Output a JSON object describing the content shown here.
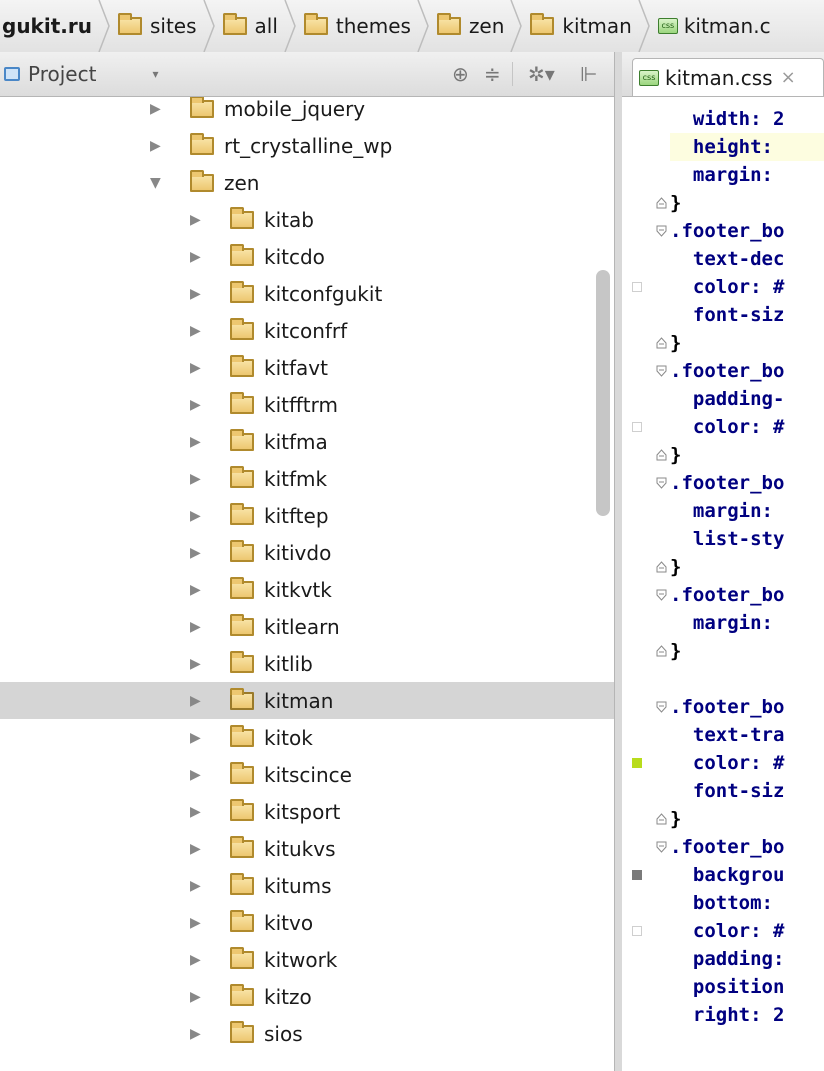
{
  "breadcrumb": {
    "items": [
      {
        "label": "gukit.ru",
        "icon": "none"
      },
      {
        "label": "sites",
        "icon": "folder-icon"
      },
      {
        "label": "all",
        "icon": "folder-icon"
      },
      {
        "label": "themes",
        "icon": "folder-icon"
      },
      {
        "label": "zen",
        "icon": "folder-icon"
      },
      {
        "label": "kitman",
        "icon": "folder-icon"
      },
      {
        "label": "kitman.c",
        "icon": "css-file-icon"
      }
    ]
  },
  "project_panel": {
    "title": "Project",
    "dropdown_glyph": "▾",
    "tools": {
      "locate": "⊕",
      "collapse": "≑",
      "settings": "✲▾",
      "hide": "⊩"
    },
    "tree": [
      {
        "label": "mobile_jquery",
        "expanded": false,
        "level": 1
      },
      {
        "label": "rt_crystalline_wp",
        "expanded": false,
        "level": 1
      },
      {
        "label": "zen",
        "expanded": true,
        "level": 1
      },
      {
        "label": "kitab",
        "expanded": false,
        "level": 2
      },
      {
        "label": "kitcdo",
        "expanded": false,
        "level": 2
      },
      {
        "label": "kitconfgukit",
        "expanded": false,
        "level": 2
      },
      {
        "label": "kitconfrf",
        "expanded": false,
        "level": 2
      },
      {
        "label": "kitfavt",
        "expanded": false,
        "level": 2
      },
      {
        "label": "kitfftrm",
        "expanded": false,
        "level": 2
      },
      {
        "label": "kitfma",
        "expanded": false,
        "level": 2
      },
      {
        "label": "kitfmk",
        "expanded": false,
        "level": 2
      },
      {
        "label": "kitftep",
        "expanded": false,
        "level": 2
      },
      {
        "label": "kitivdo",
        "expanded": false,
        "level": 2
      },
      {
        "label": "kitkvtk",
        "expanded": false,
        "level": 2
      },
      {
        "label": "kitlearn",
        "expanded": false,
        "level": 2
      },
      {
        "label": "kitlib",
        "expanded": false,
        "level": 2
      },
      {
        "label": "kitman",
        "expanded": false,
        "level": 2,
        "selected": true
      },
      {
        "label": "kitok",
        "expanded": false,
        "level": 2
      },
      {
        "label": "kitscince",
        "expanded": false,
        "level": 2
      },
      {
        "label": "kitsport",
        "expanded": false,
        "level": 2
      },
      {
        "label": "kitukvs",
        "expanded": false,
        "level": 2
      },
      {
        "label": "kitums",
        "expanded": false,
        "level": 2
      },
      {
        "label": "kitvo",
        "expanded": false,
        "level": 2
      },
      {
        "label": "kitwork",
        "expanded": false,
        "level": 2
      },
      {
        "label": "kitzo",
        "expanded": false,
        "level": 2
      },
      {
        "label": "sios",
        "expanded": false,
        "level": 2
      }
    ]
  },
  "editor": {
    "tab": {
      "label": "kitman.css",
      "icon": "css-file-icon",
      "close": "×"
    },
    "lines": [
      {
        "text": "  width: 2",
        "kind": "prop"
      },
      {
        "text": "  height: ",
        "kind": "prop",
        "highlight": true
      },
      {
        "text": "  margin: ",
        "kind": "prop"
      },
      {
        "text": "}",
        "kind": "brace",
        "fold": "end"
      },
      {
        "text": ".footer_bo",
        "kind": "selector",
        "fold": "start"
      },
      {
        "text": "  text-dec",
        "kind": "prop"
      },
      {
        "text": "  color: #",
        "kind": "prop",
        "swatch": "#ffffff"
      },
      {
        "text": "  font-siz",
        "kind": "prop"
      },
      {
        "text": "}",
        "kind": "brace",
        "fold": "end"
      },
      {
        "text": ".footer_bo",
        "kind": "selector",
        "fold": "start"
      },
      {
        "text": "  padding-",
        "kind": "prop"
      },
      {
        "text": "  color: #",
        "kind": "prop",
        "swatch": "#ffffff"
      },
      {
        "text": "}",
        "kind": "brace",
        "fold": "end"
      },
      {
        "text": ".footer_bo",
        "kind": "selector",
        "fold": "start"
      },
      {
        "text": "  margin: ",
        "kind": "prop"
      },
      {
        "text": "  list-sty",
        "kind": "prop"
      },
      {
        "text": "}",
        "kind": "brace",
        "fold": "end"
      },
      {
        "text": ".footer_bo",
        "kind": "selector",
        "fold": "start"
      },
      {
        "text": "  margin: ",
        "kind": "prop"
      },
      {
        "text": "}",
        "kind": "brace",
        "fold": "end"
      },
      {
        "text": "",
        "kind": "blank"
      },
      {
        "text": ".footer_bo",
        "kind": "selector",
        "fold": "start"
      },
      {
        "text": "  text-tra",
        "kind": "prop"
      },
      {
        "text": "  color: #",
        "kind": "prop",
        "swatch": "#b8dc1c"
      },
      {
        "text": "  font-siz",
        "kind": "prop"
      },
      {
        "text": "}",
        "kind": "brace",
        "fold": "end"
      },
      {
        "text": ".footer_bo",
        "kind": "selector",
        "fold": "start"
      },
      {
        "text": "  backgrou",
        "kind": "prop",
        "swatch": "#7a7a7a"
      },
      {
        "text": "  bottom: ",
        "kind": "prop"
      },
      {
        "text": "  color: #",
        "kind": "prop",
        "swatch": "#ffffff"
      },
      {
        "text": "  padding:",
        "kind": "prop"
      },
      {
        "text": "  position",
        "kind": "prop"
      },
      {
        "text": "  right: 2",
        "kind": "prop"
      }
    ]
  },
  "colors": {
    "selection_row": "#d5d5d5",
    "code_keyword": "#000080",
    "line_highlight": "#fdfde0"
  }
}
